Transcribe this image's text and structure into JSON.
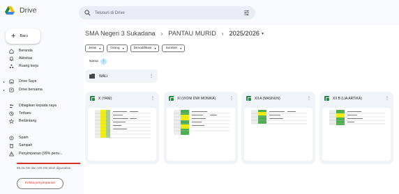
{
  "app": {
    "name": "Drive"
  },
  "search": {
    "placeholder": "Telusuri di Drive"
  },
  "sidebar": {
    "new_label": "Baru",
    "items": [
      {
        "label": "Beranda",
        "icon": "home-icon"
      },
      {
        "label": "Aktivitas",
        "icon": "bell-icon"
      },
      {
        "label": "Ruang kerja",
        "icon": "workspace-icon"
      },
      {
        "label": "Drive Saya",
        "icon": "my-drive-icon"
      },
      {
        "label": "Drive bersama",
        "icon": "shared-drive-icon"
      },
      {
        "label": "Dibagikan kepada saya",
        "icon": "shared-with-me-icon"
      },
      {
        "label": "Terbaru",
        "icon": "clock-icon"
      },
      {
        "label": "Berbintang",
        "icon": "star-icon"
      },
      {
        "label": "Spam",
        "icon": "spam-icon"
      },
      {
        "label": "Sampah",
        "icon": "trash-icon"
      },
      {
        "label": "Penyimpanan (99% penu...",
        "icon": "cloud-warning-icon"
      }
    ],
    "storage": {
      "text": "99,3a GB dari 100 GB telah digunakan",
      "fraction": 0.993,
      "button": "Kelola penyimpanan"
    }
  },
  "breadcrumb": {
    "items": [
      "SMA Negeri 3 Sukadana",
      "PANTAU MURID",
      "2025/2026"
    ]
  },
  "filters": [
    "Jenis",
    "Orang",
    "Dimodifikasi",
    "Sumber"
  ],
  "sort": {
    "label": "Nama"
  },
  "folders": [
    {
      "name": "WALI"
    }
  ],
  "files": [
    {
      "name": "X (YANI)"
    },
    {
      "name": "XI (VIONI DWI MONIKA)"
    },
    {
      "name": "XII A (MASNUN)"
    },
    {
      "name": "XII B (LIA ARTIKA)"
    }
  ],
  "colors": {
    "accent": "#0b57d0",
    "sheet": "#1e8e3e",
    "warning": "#d93025"
  }
}
